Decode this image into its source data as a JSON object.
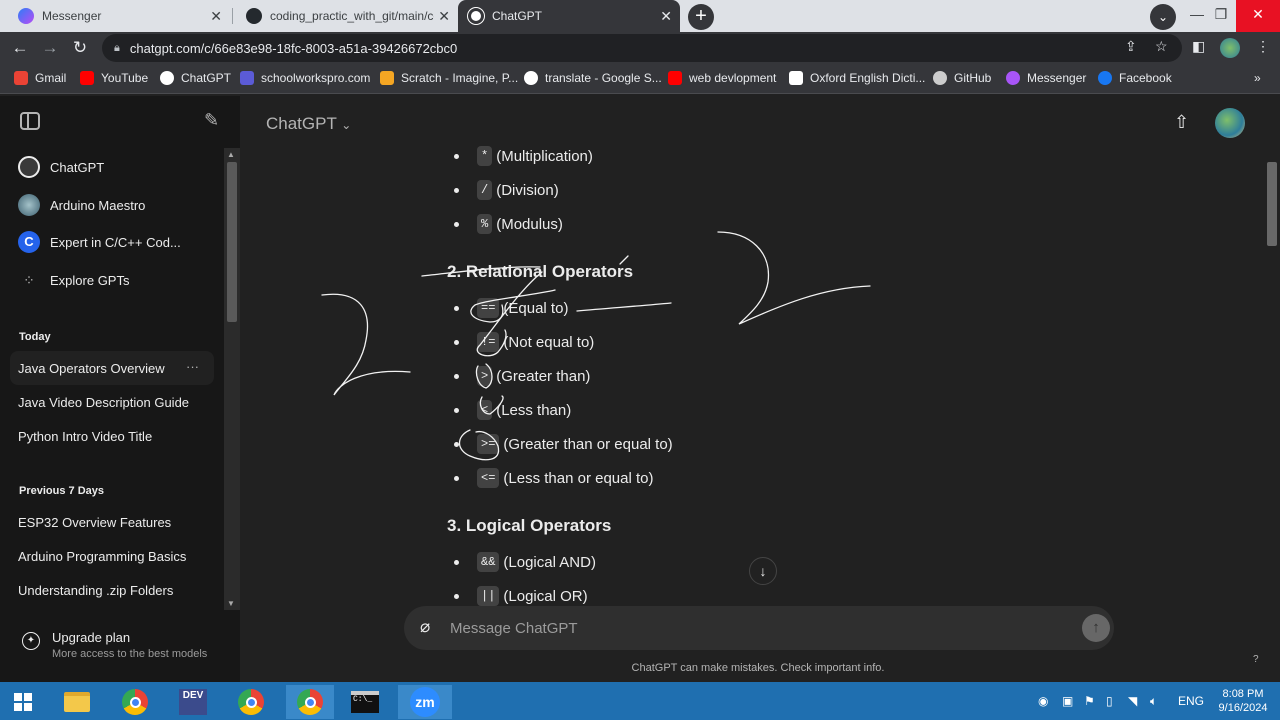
{
  "browser": {
    "tabs": [
      {
        "title": "Messenger",
        "icon": "messenger-icon"
      },
      {
        "title": "coding_practic_with_git/main/co",
        "icon": "github-icon"
      },
      {
        "title": "ChatGPT",
        "icon": "chatgpt-icon"
      }
    ],
    "url": "chatgpt.com/c/66e83e98-18fc-8003-a51a-39426672cbc0",
    "bookmarks": [
      {
        "label": "Gmail",
        "color": "#ea4335"
      },
      {
        "label": "YouTube",
        "color": "#ff0000"
      },
      {
        "label": "ChatGPT",
        "color": "#ffffff"
      },
      {
        "label": "schoolworkspro.com",
        "color": "#5b5bd6"
      },
      {
        "label": "Scratch - Imagine, P...",
        "color": "#f5a623"
      },
      {
        "label": "translate - Google S...",
        "color": "#ffffff"
      },
      {
        "label": "web devlopment",
        "color": "#ff0000"
      },
      {
        "label": "Oxford English Dicti...",
        "color": "#ffffff"
      },
      {
        "label": "GitHub",
        "color": "#cccccc"
      },
      {
        "label": "Messenger",
        "color": "#a855f7"
      },
      {
        "label": "Facebook",
        "color": "#1877f2"
      }
    ]
  },
  "sidebar": {
    "gpts": [
      {
        "label": "ChatGPT",
        "color": "#3a3a3a"
      },
      {
        "label": "Arduino Maestro",
        "color": "#5f7f8f"
      },
      {
        "label": "Expert in C/C++ Cod...",
        "color": "#2563eb"
      },
      {
        "label": "Explore GPTs",
        "color": "#171717"
      }
    ],
    "today_label": "Today",
    "today": [
      "Java Operators Overview",
      "Java Video Description Guide",
      "Python Intro Video Title"
    ],
    "prev_label": "Previous 7 Days",
    "prev": [
      "ESP32 Overview Features",
      "Arduino Programming Basics",
      "Understanding .zip Folders"
    ],
    "upgrade_title": "Upgrade plan",
    "upgrade_sub": "More access to the best models",
    "more_label": "···"
  },
  "main": {
    "model": "ChatGPT",
    "arith_items": [
      {
        "code": "*",
        "text": "(Multiplication)"
      },
      {
        "code": "/",
        "text": "(Division)"
      },
      {
        "code": "%",
        "text": "(Modulus)"
      }
    ],
    "relational_heading": "2. Relational Operators",
    "relational_items": [
      {
        "code": "==",
        "text": "(Equal to)"
      },
      {
        "code": "!=",
        "text": "(Not equal to)"
      },
      {
        "code": ">",
        "text": "(Greater than)"
      },
      {
        "code": "<",
        "text": "(Less than)"
      },
      {
        "code": ">=",
        "text": "(Greater than or equal to)"
      },
      {
        "code": "<=",
        "text": "(Less than or equal to)"
      }
    ],
    "logical_heading": "3. Logical Operators",
    "logical_items": [
      {
        "code": "&&",
        "text": "(Logical AND)"
      },
      {
        "code": "||",
        "text": "(Logical OR)"
      }
    ],
    "input_placeholder": "Message ChatGPT",
    "disclaimer": "ChatGPT can make mistakes. Check important info.",
    "help": "?"
  },
  "taskbar": {
    "lang": "ENG",
    "time": "8:08 PM",
    "date": "9/16/2024",
    "zoom_label": "zm",
    "dev_label": "DEV"
  }
}
